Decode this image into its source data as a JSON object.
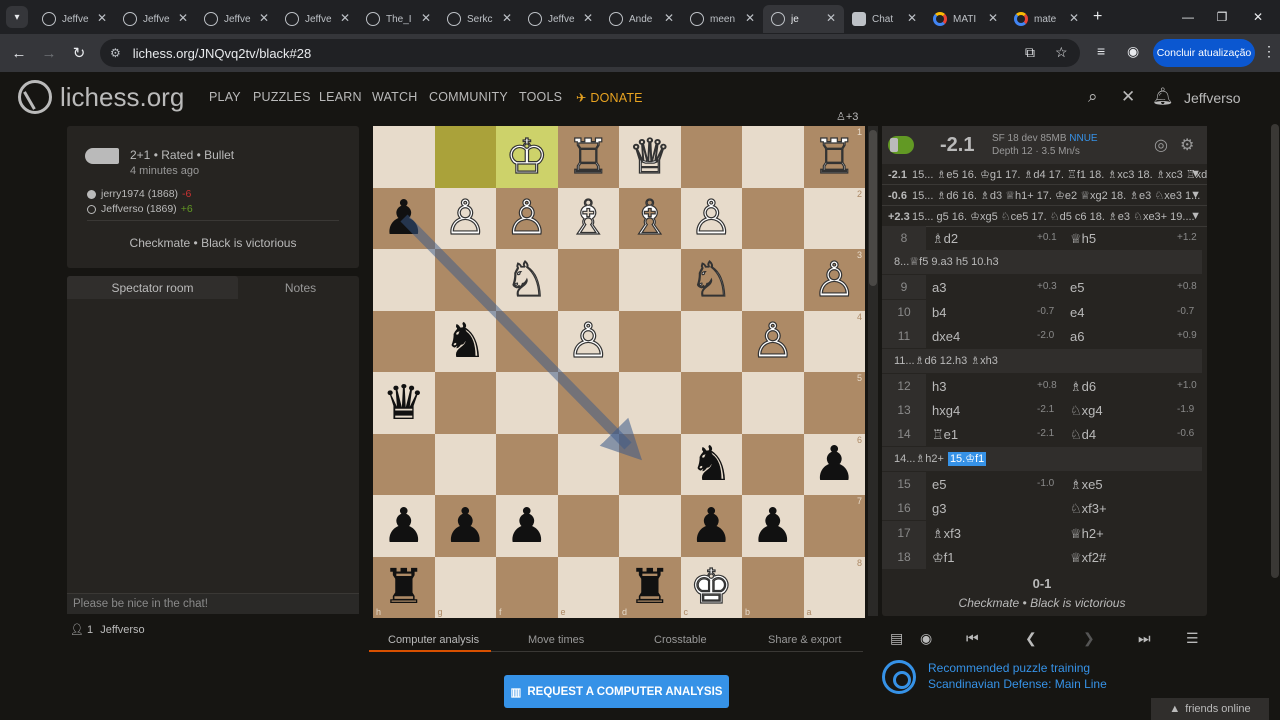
{
  "browser": {
    "tabs": [
      {
        "title": "Jeffve",
        "icon": "lichess"
      },
      {
        "title": "Jeffve",
        "icon": "lichess"
      },
      {
        "title": "Jeffve",
        "icon": "lichess"
      },
      {
        "title": "Jeffve",
        "icon": "lichess"
      },
      {
        "title": "The_I",
        "icon": "lichess"
      },
      {
        "title": "Serkc",
        "icon": "lichess"
      },
      {
        "title": "Jeffve",
        "icon": "lichess"
      },
      {
        "title": "Ande",
        "icon": "lichess"
      },
      {
        "title": "meen",
        "icon": "lichess"
      },
      {
        "title": "je",
        "icon": "lichess"
      },
      {
        "title": "Chat",
        "icon": "chat"
      },
      {
        "title": "MATI",
        "icon": "google"
      },
      {
        "title": "mate",
        "icon": "google"
      }
    ],
    "url": "lichess.org/JNQvq2tv/black#28",
    "update_label": "Concluir atualização"
  },
  "nav": {
    "logo": "lichess.org",
    "items": [
      "PLAY",
      "PUZZLES",
      "LEARN",
      "WATCH",
      "COMMUNITY",
      "TOOLS"
    ],
    "donate": "DONATE",
    "username": "Jeffverso"
  },
  "game": {
    "mode": "2+1 • Rated • Bullet",
    "time_ago": "4 minutes ago",
    "players": [
      {
        "name": "jerry1974 (1868)",
        "diff": "-6",
        "color": "black"
      },
      {
        "name": "Jeffverso (1869)",
        "diff": "+6",
        "color": "white"
      }
    ],
    "result": "Checkmate • Black is victorious"
  },
  "chat": {
    "tabs": [
      "Spectator room",
      "Notes"
    ],
    "placeholder": "Please be nice in the chat!",
    "watchers_count": "1",
    "watcher": "Jeffverso"
  },
  "board": {
    "material": "+3",
    "ranks": [
      "1",
      "2",
      "3",
      "4",
      "5",
      "6",
      "7",
      "8"
    ],
    "files": [
      "h",
      "g",
      "f",
      "e",
      "d",
      "c",
      "b",
      "a"
    ],
    "rows": [
      [
        "",
        "",
        "♔",
        "♖",
        "♕",
        "",
        "",
        "♖"
      ],
      [
        "♟",
        "♙",
        "♙",
        "♗",
        "♗",
        "♙",
        "",
        ""
      ],
      [
        "",
        "",
        "♘",
        "",
        "",
        "♘",
        "",
        "♙"
      ],
      [
        "",
        "♞",
        "",
        "♙",
        "",
        "",
        "♙",
        ""
      ],
      [
        "♛",
        "",
        "",
        "",
        "",
        "",
        "",
        ""
      ],
      [
        "",
        "",
        "",
        "",
        "",
        "♞",
        "",
        "♟"
      ],
      [
        "♟",
        "♟",
        "♟",
        "",
        "",
        "♟",
        "♟",
        ""
      ],
      [
        "♜",
        "",
        "",
        "",
        "♜",
        "♚",
        "",
        ""
      ]
    ],
    "colors": [
      [
        "w",
        "w",
        "w",
        "w",
        "w",
        "",
        "",
        "w"
      ],
      [
        "b",
        "w",
        "w",
        "w",
        "w",
        "w",
        "",
        ""
      ],
      [
        "",
        "",
        "w",
        "",
        "",
        "w",
        "",
        "w"
      ],
      [
        "",
        "b",
        "",
        "w",
        "",
        "",
        "w",
        ""
      ],
      [
        "b",
        "",
        "",
        "",
        "",
        "",
        "",
        ""
      ],
      [
        "",
        "",
        "",
        "",
        "",
        "b",
        "",
        "b"
      ],
      [
        "b",
        "b",
        "b",
        "",
        "",
        "b",
        "b",
        ""
      ],
      [
        "b",
        "",
        "",
        "",
        "b",
        "w",
        "",
        ""
      ]
    ],
    "highlight": [
      [
        0,
        1
      ],
      [
        0,
        2
      ]
    ]
  },
  "analysis": {
    "eval": "-2.1",
    "engine": "SF 18 dev 85MB",
    "nnue": "NNUE",
    "depth": "Depth 12 · 3.5 Mn/s",
    "pvs": [
      {
        "score": "-2.1",
        "line": "15... ♗e5 16. ♔g1 17. ♗d4 17. ♖f1 18. ♗xc3 18. ♗xc3 ♖xd1 19..."
      },
      {
        "score": "-0.6",
        "line": "15... ♗d6 16. ♗d3 ♕h1+ 17. ♔e2 ♕xg2 18. ♗e3 ♘xe3 1..."
      },
      {
        "score": "+2.3",
        "line": "15... g5 16. ♔xg5 ♘ce5 17. ♘d5 c6 18. ♗e3 ♘xe3+ 19...."
      }
    ],
    "moves": [
      {
        "n": "8",
        "w": "♗d2",
        "we": "+0.1",
        "b": "♕h5",
        "be": "+1.2"
      },
      {
        "var": "8...♕f5  9.a3  h5  10.h3"
      },
      {
        "n": "9",
        "w": "a3",
        "we": "+0.3",
        "b": "e5",
        "be": "+0.8"
      },
      {
        "n": "10",
        "w": "b4",
        "we": "-0.7",
        "b": "e4",
        "be": "-0.7"
      },
      {
        "n": "11",
        "w": "dxe4",
        "we": "-2.0",
        "b": "a6",
        "be": "+0.9"
      },
      {
        "var": "11...♗d6  12.h3  ♗xh3"
      },
      {
        "n": "12",
        "w": "h3",
        "we": "+0.8",
        "b": "♗d6",
        "be": "+1.0"
      },
      {
        "n": "13",
        "w": "hxg4",
        "we": "-2.1",
        "b": "♘xg4",
        "be": "-1.9"
      },
      {
        "n": "14",
        "w": "♖e1",
        "we": "-2.1",
        "b": "♘d4",
        "be": "-0.6"
      },
      {
        "var": "14...♗h2+",
        "cur": "15.♔f1"
      },
      {
        "n": "15",
        "w": "e5",
        "we": "-1.0",
        "b": "♗xe5",
        "be": ""
      },
      {
        "n": "16",
        "w": "g3",
        "we": "",
        "b": "♘xf3+",
        "be": ""
      },
      {
        "n": "17",
        "w": "♗xf3",
        "we": "",
        "b": "♕h2+",
        "be": ""
      },
      {
        "n": "18",
        "w": "♔f1",
        "we": "",
        "b": "♕xf2#",
        "be": ""
      }
    ],
    "score": "0-1",
    "result": "Checkmate • Black is victorious"
  },
  "under_tabs": [
    "Computer analysis",
    "Move times",
    "Crosstable",
    "Share & export"
  ],
  "request_button": "REQUEST A COMPUTER ANALYSIS",
  "puzzle": {
    "line1": "Recommended puzzle training",
    "line2": "Scandinavian Defense: Main Line"
  },
  "friends": "friends online"
}
